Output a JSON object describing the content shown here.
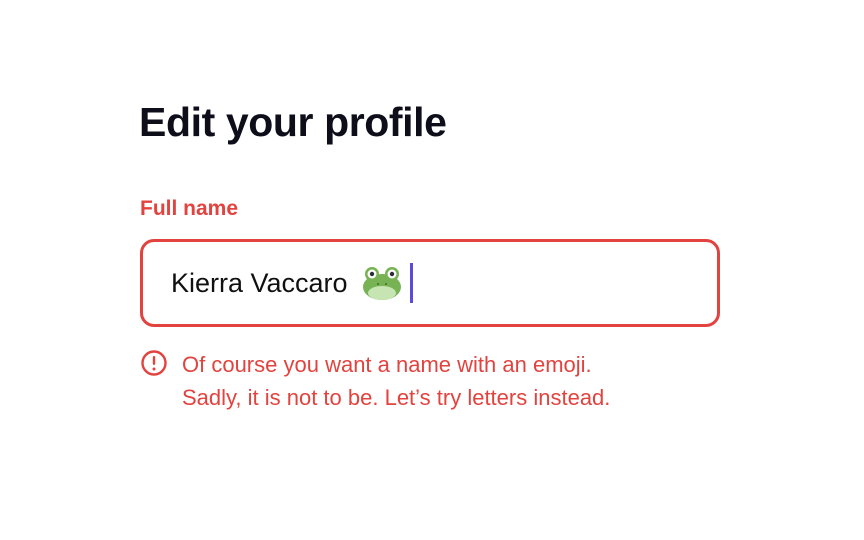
{
  "form": {
    "title": "Edit your profile",
    "full_name_label": "Full name",
    "full_name_value": "Kierra Vaccaro",
    "full_name_emoji_icon": "frog-face-icon",
    "error": {
      "icon": "alert-circle-icon",
      "line1": "Of course you want a name with an emoji.",
      "line2": "Sadly, it is not to be. Let’s try letters instead."
    }
  },
  "colors": {
    "error": "#e2433f",
    "title": "#0d0e1a",
    "caret": "#5b4bdb"
  }
}
